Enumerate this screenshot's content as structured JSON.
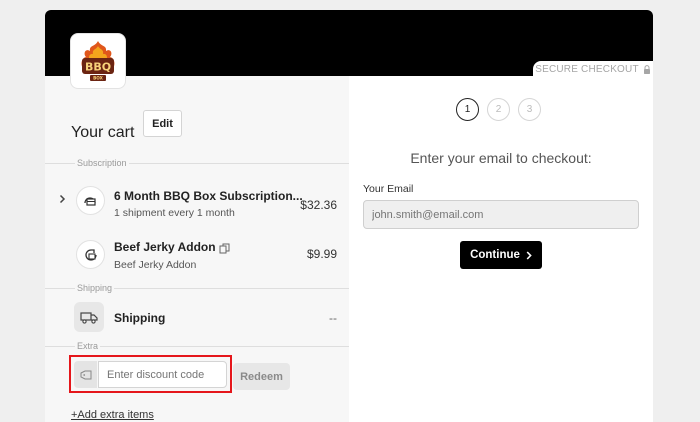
{
  "header": {
    "secure_label": "SECURE CHECKOUT",
    "logo_text": "BBQ",
    "logo_subtext": "BOX"
  },
  "cart": {
    "title": "Your cart",
    "edit_label": "Edit",
    "sections": {
      "subscription": "Subscription",
      "shipping": "Shipping",
      "extra": "Extra"
    },
    "items": [
      {
        "name": "6 Month BBQ Box Subscription...",
        "sub": "1 shipment every 1 month",
        "price": "$32.36",
        "icon": "subscription-box-icon"
      },
      {
        "name": "Beef Jerky Addon",
        "sub": "Beef Jerky Addon",
        "price": "$9.99",
        "icon": "one-time-icon"
      }
    ],
    "shipping": {
      "label": "Shipping",
      "price": "--",
      "icon": "truck-icon"
    },
    "discount": {
      "placeholder": "Enter discount code",
      "redeem_label": "Redeem",
      "icon": "tag-icon"
    },
    "add_extra_label": "+Add extra items"
  },
  "checkout": {
    "steps": [
      "1",
      "2",
      "3"
    ],
    "active_step": 1,
    "heading": "Enter your email to checkout:",
    "email_label": "Your Email",
    "email_placeholder": "john.smith@email.com",
    "continue_label": "Continue"
  },
  "colors": {
    "header_bg": "#000000",
    "highlight": "#e5161b",
    "left_panel_bg": "#f7f7f7",
    "button_bg": "#000000"
  }
}
